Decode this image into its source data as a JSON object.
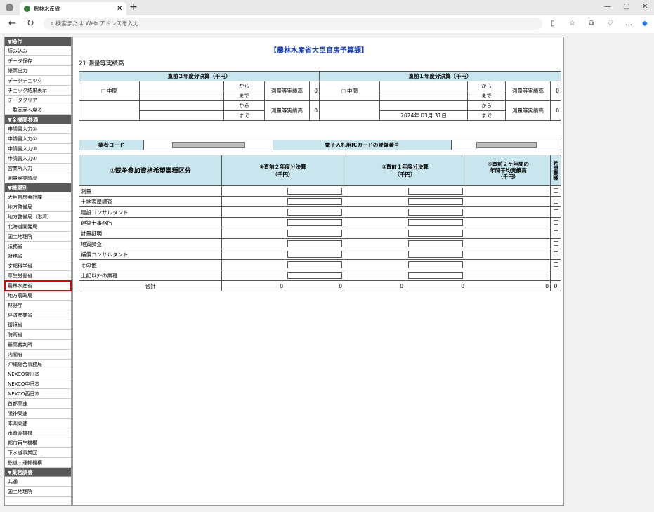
{
  "browser": {
    "tab_title": "農林水産省",
    "tab_close": "✕",
    "new_tab": "+",
    "address_placeholder": "検索または Web アドレスを入力",
    "window_controls": [
      "—",
      "▢",
      "✕"
    ]
  },
  "sidebar": {
    "sections": [
      {
        "title": "▼操作",
        "items": [
          "読み込み",
          "データ保存",
          "帳票出力",
          "データチェック",
          "チェック結果表示",
          "データクリア",
          "一覧画面へ戻る"
        ]
      },
      {
        "title": "▼全機関共通",
        "items": [
          "申請書入力①",
          "申請書入力②",
          "申請書入力③",
          "申請書入力④",
          "営業所入力",
          "測量等実績高"
        ]
      },
      {
        "title": "▼機関別",
        "items": [
          "大臣官房会計課",
          "地方整備局",
          "地方整備局（港湾）",
          "北海道開発局",
          "国土地理院",
          "法務省",
          "財務省",
          "文部科学省",
          "厚生労働省",
          "農林水産省",
          "地方農政局",
          "林野庁",
          "経済産業省",
          "環境省",
          "防衛省",
          "最高裁判所",
          "内閣府",
          "沖縄総合事務局",
          "NEXCO東日本",
          "NEXCO中日本",
          "NEXCO西日本",
          "首都高速",
          "阪神高速",
          "本四高速",
          "水資源機構",
          "都市再生機構",
          "下水道事業団",
          "鉄道・運輸機構"
        ]
      },
      {
        "title": "▼業務調書",
        "items": [
          "共通",
          "国土地理院"
        ]
      }
    ],
    "active_item": "農林水産省"
  },
  "main": {
    "heading": "【農林水産省大臣官房予算課】",
    "subtitle": "21 測量等実績高",
    "period": {
      "left_header": "直前２年度分決算（千円）",
      "right_header": "直前１年度分決算（千円）",
      "middle_label": "中間",
      "from_label": "から",
      "to_label": "まで",
      "amount_label": "測量等実績高",
      "rows": [
        {
          "left_amount": "0",
          "right_amount": "0",
          "right_to_date": ""
        },
        {
          "left_amount": "0",
          "right_amount": "0",
          "right_to_date": "2024年 03月 31日"
        }
      ]
    },
    "vendor": {
      "code_label": "業者コード",
      "ic_label": "電子入札用ICカードの登録番号"
    },
    "categories": {
      "col1": "①競争参加資格希望業種区分",
      "col2": "②直前２年度分決算\n（千円）",
      "col3": "③直前１年度分決算\n（千円）",
      "col4": "④直前２ヶ年間の\n年間平均実績高\n（千円）",
      "col5": "希望業種",
      "rows": [
        "測量",
        "土地家屋調査",
        "建設コンサルタント",
        "建築士事務所",
        "計量証明",
        "地質調査",
        "補償コンサルタント",
        "その他",
        "上記以外の業種"
      ],
      "total_label": "合計",
      "totals": [
        "0",
        "0",
        "0",
        "0",
        "0",
        "0"
      ]
    }
  }
}
